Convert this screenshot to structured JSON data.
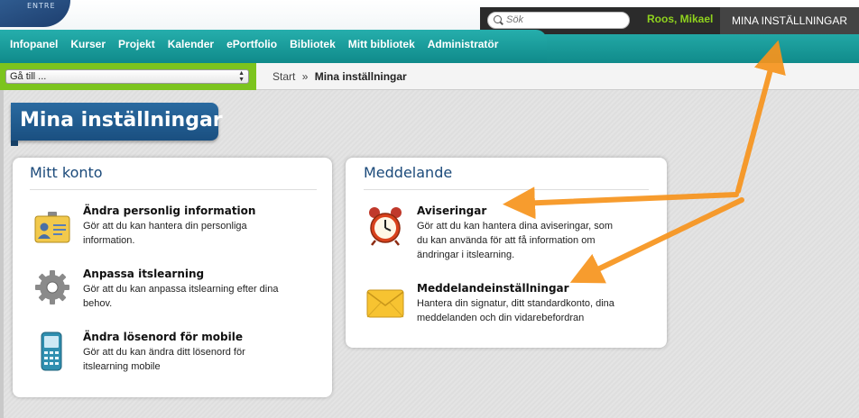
{
  "header": {
    "search_placeholder": "Sök",
    "user_name": "Roos, Mikael",
    "settings_link": "MINA INSTÄLLNINGAR"
  },
  "nav": {
    "items": [
      "Infopanel",
      "Kurser",
      "Projekt",
      "Kalender",
      "ePortfolio",
      "Bibliotek",
      "Mitt bibliotek",
      "Administratör"
    ]
  },
  "subbar": {
    "goto_label": "Gå till ...",
    "breadcrumb_start": "Start",
    "breadcrumb_sep": "»",
    "breadcrumb_current": "Mina inställningar"
  },
  "page": {
    "title": "Mina inställningar"
  },
  "mitt_konto": {
    "heading": "Mitt konto",
    "items": [
      {
        "title": "Ändra personlig information",
        "desc1": "Gör att du kan hantera din personliga",
        "desc2": "information.",
        "icon": "id-card-icon"
      },
      {
        "title": "Anpassa itslearning",
        "desc1": "Gör att du kan anpassa itslearning efter dina",
        "desc2": "behov.",
        "icon": "gear-icon"
      },
      {
        "title": "Ändra lösenord för mobile",
        "desc1": "Gör att du kan ändra ditt lösenord för",
        "desc2": "itslearning mobile",
        "icon": "mobile-phone-icon"
      }
    ]
  },
  "meddelande": {
    "heading": "Meddelande",
    "items": [
      {
        "title": "Aviseringar",
        "desc1": "Gör att du kan hantera dina aviseringar, som",
        "desc2": "du kan använda för att få information om",
        "desc3": "ändringar i itslearning.",
        "icon": "alarm-clock-icon"
      },
      {
        "title": "Meddelandeinställningar",
        "desc1": "Hantera din signatur, ditt standardkonto, dina",
        "desc2": "meddelanden och din vidarebefordran",
        "icon": "envelope-icon"
      }
    ]
  },
  "colors": {
    "nav_teal": "#149a98",
    "user_green": "#8fd21e",
    "title_blue": "#1b4a7a",
    "arrow_orange": "#f7941d"
  }
}
